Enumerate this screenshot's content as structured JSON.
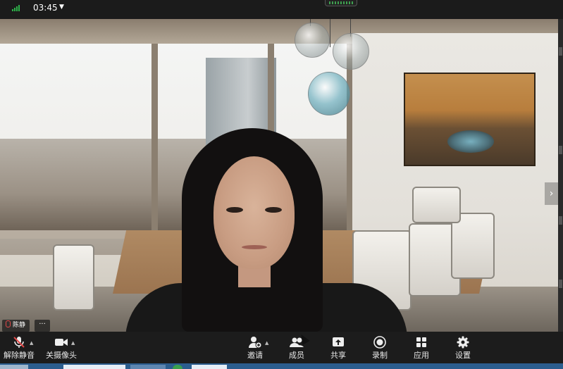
{
  "status_bar": {
    "time": "03:45"
  },
  "participant": {
    "name": "陈静",
    "more": "···"
  },
  "toolbar": {
    "unmute_label": "解除静音",
    "stop_video_label": "关摄像头",
    "invite_label": "邀请",
    "participants_label": "成员",
    "share_label": "共享",
    "record_label": "录制",
    "apps_label": "应用",
    "settings_label": "设置"
  },
  "colors": {
    "toolbar_bg": "#1c1c1c",
    "muted_red": "#e04848",
    "signal_green": "#2db34a"
  }
}
